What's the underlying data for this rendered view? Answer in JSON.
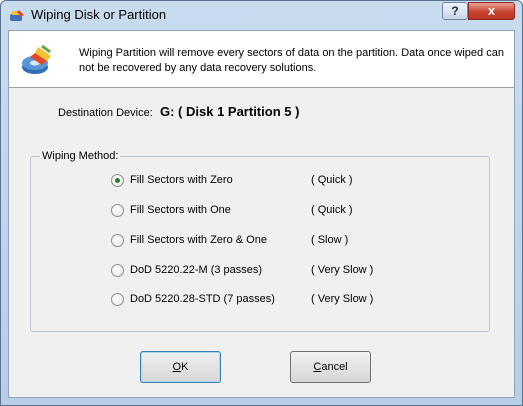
{
  "window": {
    "title": "Wiping Disk or Partition"
  },
  "title_buttons": {
    "help": "?",
    "close": "x"
  },
  "banner": {
    "text": "Wiping Partition will remove every sectors of data on the partition. Data once wiped can not be recovered by any data recovery solutions."
  },
  "destination": {
    "label": "Destination Device:",
    "value": "G: ( Disk 1 Partition 5 )"
  },
  "method": {
    "legend": "Wiping Method:",
    "options": [
      {
        "label": "Fill Sectors with Zero",
        "speed": "( Quick )",
        "selected": true
      },
      {
        "label": "Fill Sectors with One",
        "speed": "( Quick )",
        "selected": false
      },
      {
        "label": "Fill Sectors with Zero & One",
        "speed": "( Slow )",
        "selected": false
      },
      {
        "label": "DoD 5220.22-M (3 passes)",
        "speed": "( Very Slow )",
        "selected": false
      },
      {
        "label": "DoD 5220.28-STD (7 passes)",
        "speed": "( Very Slow )",
        "selected": false
      }
    ]
  },
  "buttons": {
    "ok_mnemonic": "O",
    "ok_rest": "K",
    "cancel_mnemonic": "C",
    "cancel_rest": "ancel"
  }
}
